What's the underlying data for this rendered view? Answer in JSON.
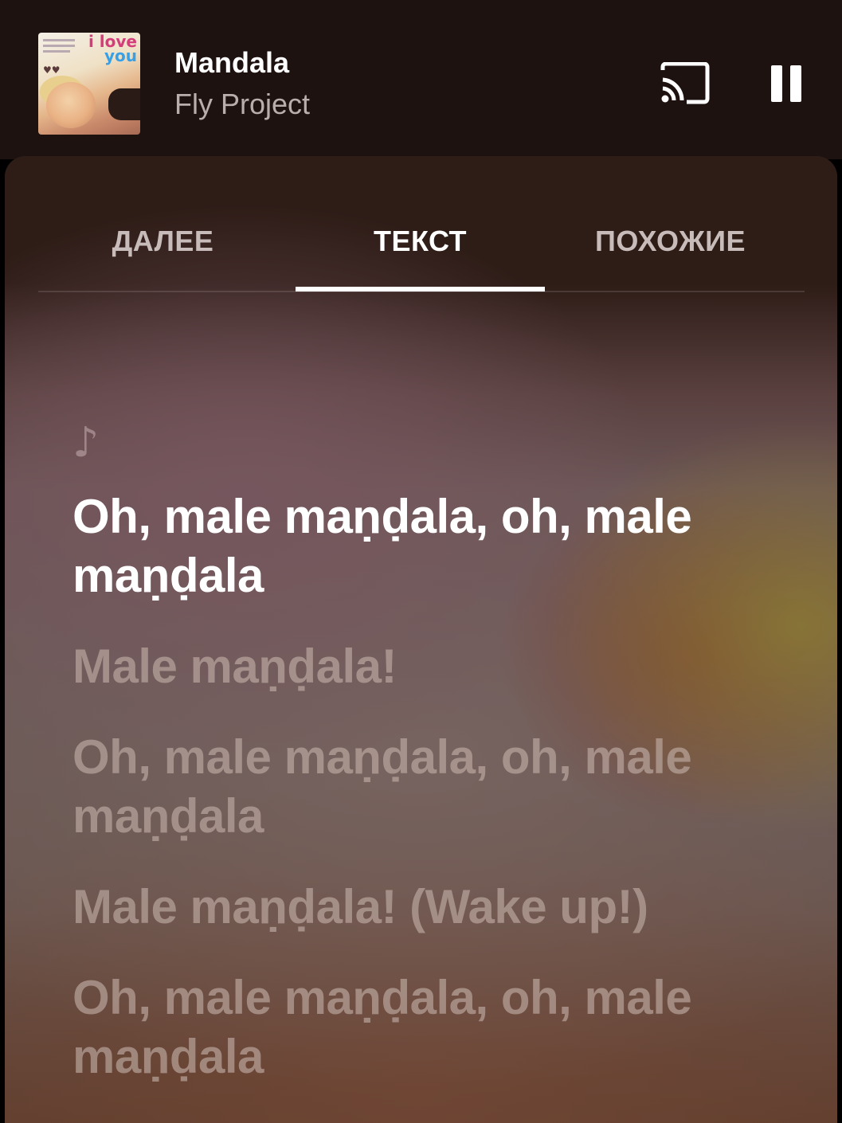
{
  "player": {
    "song_title": "Mandala",
    "artist": "Fly Project",
    "cover_text": [
      "i love",
      "you"
    ],
    "cast_icon": "cast-icon",
    "pause_icon": "pause-icon"
  },
  "tabs": [
    {
      "label": "ДАЛЕЕ",
      "active": false
    },
    {
      "label": "ТЕКСТ",
      "active": true
    },
    {
      "label": "ПОХОЖИЕ",
      "active": false
    }
  ],
  "lyrics": {
    "note_symbol": "♪",
    "lines": [
      {
        "text": "Oh, male maṇḍala, oh, male maṇḍala",
        "current": true
      },
      {
        "text": "Male maṇḍala!",
        "current": false
      },
      {
        "text": "Oh, male maṇḍala, oh, male maṇḍala",
        "current": false
      },
      {
        "text": "Male maṇḍala! (Wake up!)",
        "current": false
      },
      {
        "text": "Oh, male maṇḍala, oh, male maṇḍala",
        "current": false
      }
    ]
  },
  "colors": {
    "player_bg": "#1e1210",
    "tab_indicator": "#ffffff",
    "lyric_current": "#ffffff",
    "lyric_inactive": "#c4b0a8"
  }
}
